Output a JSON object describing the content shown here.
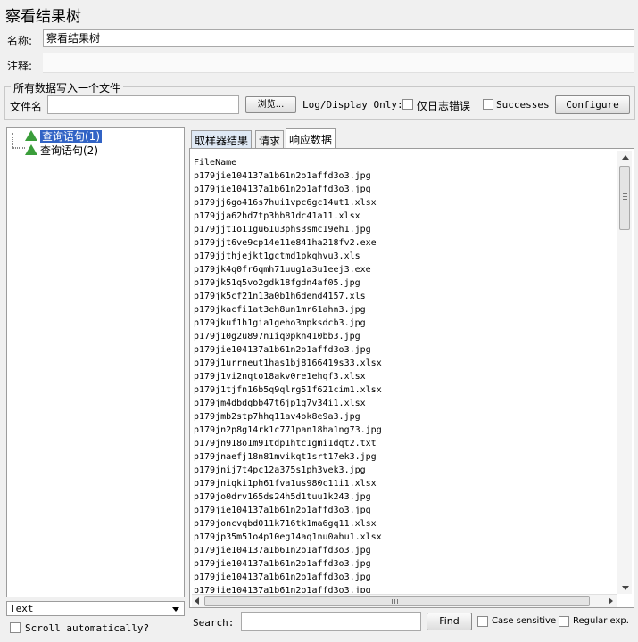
{
  "window": {
    "title": "察看结果树"
  },
  "form": {
    "name_label": "名称:",
    "name_value": "察看结果树",
    "comment_label": "注释:",
    "comment_value": ""
  },
  "file_group": {
    "legend": "所有数据写入一个文件",
    "filename_label": "文件名",
    "filename_value": "",
    "browse_label": "浏览...",
    "log_display_label": "Log/Display Only:",
    "errors_label": "仅日志错误",
    "successes_label": "Successes",
    "configure_label": "Configure"
  },
  "tree": {
    "items": [
      {
        "label": "查询语句(1)",
        "selected": true
      },
      {
        "label": "查询语句(2)",
        "selected": false
      }
    ],
    "renderer_value": "Text",
    "scroll_auto_label": "Scroll automatically?"
  },
  "tabs": [
    {
      "label": "取样器结果"
    },
    {
      "label": "请求"
    },
    {
      "label": "响应数据"
    }
  ],
  "response": {
    "lines": [
      "FileName",
      "p179jie104137a1b61n2o1affd3o3.jpg",
      "p179jie104137a1b61n2o1affd3o3.jpg",
      "p179jj6go416s7hui1vpc6gc14ut1.xlsx",
      "p179jja62hd7tp3hb81dc41a11.xlsx",
      "p179jjt1o11gu61u3phs3smc19eh1.jpg",
      "p179jjt6ve9cp14e11e841ha218fv2.exe",
      "p179jjthjejkt1gctmd1pkqhvu3.xls",
      "p179jk4q0fr6qmh71uug1a3u1eej3.exe",
      "p179jk51q5vo2gdk18fgdn4af05.jpg",
      "p179jk5cf21n13a0b1h6dend4157.xls",
      "p179jkacfi1at3eh8un1mr61ahn3.jpg",
      "p179jkuf1h1gia1geho3mpksdcb3.jpg",
      "p179j10g2u897n1iq0pkn410bb3.jpg",
      "p179jie104137a1b61n2o1affd3o3.jpg",
      "p179j1urrneut1has1bj8166419s33.xlsx",
      "p179j1vi2nqto18akv0re1ehqf3.xlsx",
      "p179j1tjfn16b5q9qlrg51f621cim1.xlsx",
      "p179jm4dbdgbb47t6jp1g7v34i1.xlsx",
      "p179jmb2stp7hhq11av4ok8e9a3.jpg",
      "p179jn2p8g14rk1c771pan18ha1ng73.jpg",
      "p179jn918o1m91tdp1htc1gmi1dqt2.txt",
      "p179jnaefj18n81mvikqt1srt17ek3.jpg",
      "p179jnij7t4pc12a375s1ph3vek3.jpg",
      "p179jniqki1ph61fva1us980c11i1.xlsx",
      "p179jo0drv165ds24h5d1tuu1k243.jpg",
      "p179jie104137a1b61n2o1affd3o3.jpg",
      "p179joncvqbd011k716tk1ma6gq11.xlsx",
      "p179jp35m51o4p10eg14aq1nu0ahu1.xlsx",
      "p179jie104137a1b61n2o1affd3o3.jpg",
      "p179jie104137a1b61n2o1affd3o3.jpg",
      "p179jie104137a1b61n2o1affd3o3.jpg",
      "p179jie104137a1b61n2o1affd3o3.jpg"
    ]
  },
  "search": {
    "label": "Search:",
    "value": "",
    "find_label": "Find",
    "case_label": "Case sensitive",
    "regex_label": "Regular exp."
  }
}
